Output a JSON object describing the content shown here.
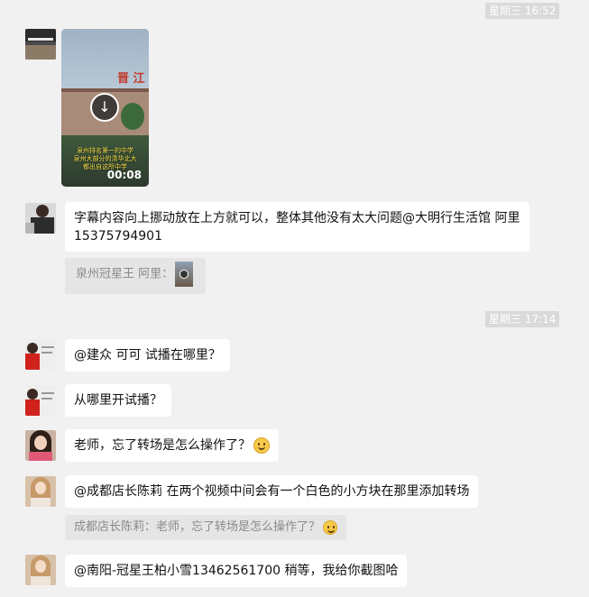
{
  "timestamps": [
    "星期三 16:52",
    "星期三 17:14"
  ],
  "video": {
    "caption_lines": [
      "泉州排名第一的中学",
      "泉州大部分的清华北大",
      "都出自这所中学"
    ],
    "duration": "00:08",
    "sign_text": "晋 江"
  },
  "messages": {
    "m1": {
      "line1": "字幕内容向上挪动放在上方就可以，整体其他没有太大问题@大明行生活馆 阿里",
      "line2": "15375794901"
    },
    "quote1": {
      "text": "泉州冠星王 阿里："
    },
    "m2": {
      "text": "@建众 可可 试播在哪里？"
    },
    "m3": {
      "text": "从哪里开试播？"
    },
    "m4": {
      "text": "老师，忘了转场是怎么操作了？"
    },
    "m5": {
      "text": "@成都店长陈莉 在两个视频中间会有一个白色的小方块在那里添加转场"
    },
    "quote2": {
      "text": "成都店长陈莉：老师，忘了转场是怎么操作了？"
    },
    "m6": {
      "text": "@南阳-冠星王柏小雪13462561700 稍等，我给你截图哈"
    }
  },
  "icons": {
    "download": "download-arrow-icon",
    "emoji": "smile-emoji-icon"
  },
  "colors": {
    "background": "#f1f1f1",
    "bubble": "#ffffff",
    "quote": "#e5e5e5",
    "timestamp_badge": "#dadada"
  }
}
